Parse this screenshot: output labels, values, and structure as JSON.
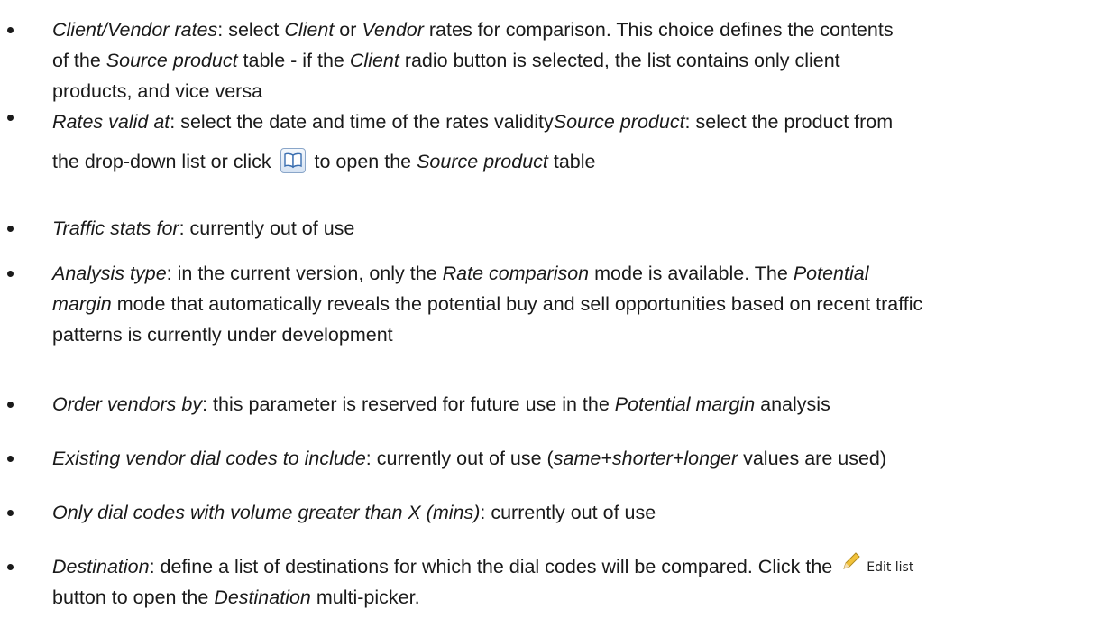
{
  "bullets": [
    {
      "lines": [
        [
          {
            "t": "Client/Vendor rates",
            "i": true
          },
          {
            "t": ": select "
          },
          {
            "t": "Client",
            "i": true
          },
          {
            "t": " or "
          },
          {
            "t": "Vendor",
            "i": true
          },
          {
            "t": " rates for comparison. This choice defines the contents"
          }
        ],
        [
          {
            "t": "of the "
          },
          {
            "t": "Source product",
            "i": true
          },
          {
            "t": " table - if the "
          },
          {
            "t": "Client",
            "i": true
          },
          {
            "t": " radio button is selected, the list contains only client"
          }
        ],
        [
          {
            "t": "products, and vice versa"
          }
        ]
      ]
    },
    {
      "lines": [
        [
          {
            "t": "Rates valid at",
            "i": true
          },
          {
            "t": ": select the date and time of the rates validity"
          },
          {
            "t": "Source product",
            "i": true
          },
          {
            "t": ": select the product from"
          }
        ],
        [
          {
            "t": "the drop-down list or click "
          },
          {
            "icon": "book-icon"
          },
          {
            "t": " to open the "
          },
          {
            "t": "Source product",
            "i": true
          },
          {
            "t": " table"
          }
        ]
      ]
    },
    {
      "lines": [
        [
          {
            "t": "Traffic stats for",
            "i": true
          },
          {
            "t": ": currently out of use"
          }
        ]
      ]
    },
    {
      "lines": [
        [
          {
            "t": "Analysis type",
            "i": true
          },
          {
            "t": ": in the current version, only the "
          },
          {
            "t": "Rate comparison",
            "i": true
          },
          {
            "t": " mode is available. The "
          },
          {
            "t": "Potential",
            "i": true
          }
        ],
        [
          {
            "t": "margin",
            "i": true
          },
          {
            "t": " mode that automatically reveals the potential buy and sell opportunities based on recent traffic"
          }
        ],
        [
          {
            "t": "patterns is currently under development"
          }
        ]
      ]
    },
    {
      "lines": [
        [
          {
            "t": "Order vendors by",
            "i": true
          },
          {
            "t": ": this parameter is reserved for future use in the "
          },
          {
            "t": "Potential margin",
            "i": true
          },
          {
            "t": " analysis"
          }
        ]
      ]
    },
    {
      "lines": [
        [
          {
            "t": "Existing vendor dial codes to include",
            "i": true
          },
          {
            "t": ": currently out of use ("
          },
          {
            "t": "same+shorter+longer",
            "i": true
          },
          {
            "t": " values are used)"
          }
        ]
      ]
    },
    {
      "lines": [
        [
          {
            "t": "Only dial codes with volume greater than X (mins)",
            "i": true
          },
          {
            "t": ": currently out of use"
          }
        ]
      ]
    },
    {
      "lines": [
        [
          {
            "t": "Destination",
            "i": true
          },
          {
            "t": ": define a list of destinations for which the dial codes will be compared. Click the "
          },
          {
            "button": "edit-list-button",
            "label": "Edit list",
            "icon": "pencil-icon"
          }
        ],
        [
          {
            "t": "button to open the "
          },
          {
            "t": "Destination",
            "i": true
          },
          {
            "t": " multi-picker."
          }
        ]
      ]
    }
  ]
}
